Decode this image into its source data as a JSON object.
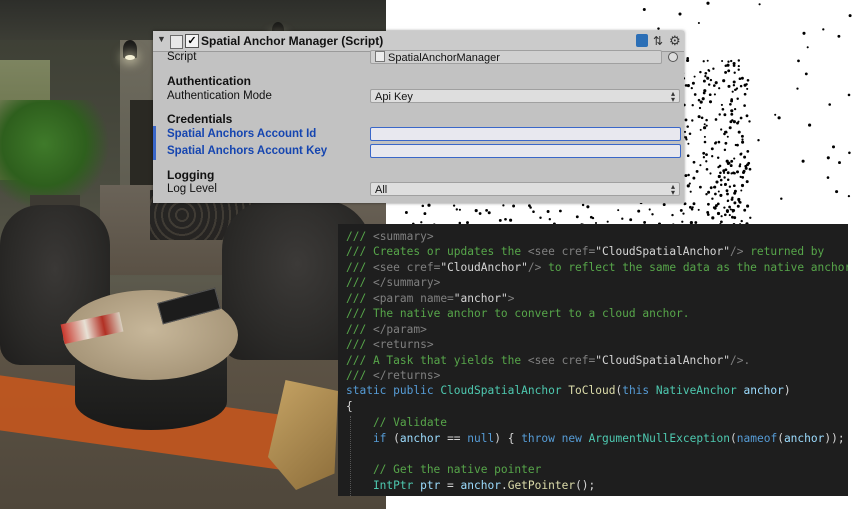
{
  "inspector": {
    "title": "Spatial Anchor Manager (Script)",
    "enabled": true,
    "script_label": "Script",
    "script_value": "SpatialAnchorManager",
    "sections": {
      "authentication": "Authentication",
      "credentials": "Credentials",
      "logging": "Logging"
    },
    "authentication_mode_label": "Authentication Mode",
    "authentication_mode_value": "Api Key",
    "account_id_label": "Spatial Anchors Account Id",
    "account_id_value": "",
    "account_key_label": "Spatial Anchors Account Key",
    "account_key_value": "",
    "log_level_label": "Log Level",
    "log_level_value": "All",
    "icons": [
      "foldout-arrow-icon",
      "script-icon",
      "enable-checkbox",
      "help-book-icon",
      "preset-sliders-icon",
      "gear-icon",
      "object-picker-icon",
      "dropdown-arrows-icon"
    ]
  },
  "code": {
    "lines": [
      {
        "parts": [
          [
            "c-cm",
            "/// "
          ],
          [
            "c-xml",
            "<summary>"
          ]
        ]
      },
      {
        "parts": [
          [
            "c-cm",
            "/// "
          ],
          [
            "c-cm",
            "Creates or updates the "
          ],
          [
            "c-xml",
            "<see "
          ],
          [
            "c-xml",
            "cref="
          ],
          [
            "c-str",
            "\"CloudSpatialAnchor\""
          ],
          [
            "c-xml",
            "/>"
          ],
          [
            "c-cm",
            " returned by"
          ]
        ]
      },
      {
        "parts": [
          [
            "c-cm",
            "/// "
          ],
          [
            "c-xml",
            "<see "
          ],
          [
            "c-xml",
            "cref="
          ],
          [
            "c-str",
            "\"CloudAnchor\""
          ],
          [
            "c-xml",
            "/>"
          ],
          [
            "c-cm",
            " to reflect the same data as the native anchor."
          ]
        ]
      },
      {
        "parts": [
          [
            "c-cm",
            "/// "
          ],
          [
            "c-xml",
            "</summary>"
          ]
        ]
      },
      {
        "parts": [
          [
            "c-cm",
            "/// "
          ],
          [
            "c-xml",
            "<param "
          ],
          [
            "c-xml",
            "name="
          ],
          [
            "c-str",
            "\"anchor\""
          ],
          [
            "c-xml",
            ">"
          ]
        ]
      },
      {
        "parts": [
          [
            "c-cm",
            "/// "
          ],
          [
            "c-cm",
            "The native anchor to convert to a cloud anchor."
          ]
        ]
      },
      {
        "parts": [
          [
            "c-cm",
            "/// "
          ],
          [
            "c-xml",
            "</param>"
          ]
        ]
      },
      {
        "parts": [
          [
            "c-cm",
            "/// "
          ],
          [
            "c-xml",
            "<returns>"
          ]
        ]
      },
      {
        "parts": [
          [
            "c-cm",
            "/// "
          ],
          [
            "c-cm",
            "A Task that yields the "
          ],
          [
            "c-xml",
            "<see "
          ],
          [
            "c-xml",
            "cref="
          ],
          [
            "c-str",
            "\"CloudSpatialAnchor\""
          ],
          [
            "c-xml",
            "/>."
          ]
        ]
      },
      {
        "parts": [
          [
            "c-cm",
            "/// "
          ],
          [
            "c-xml",
            "</returns>"
          ]
        ]
      },
      {
        "parts": [
          [
            "c-kw",
            "static "
          ],
          [
            "c-kw",
            "public "
          ],
          [
            "c-ty",
            "CloudSpatialAnchor "
          ],
          [
            "c-fn",
            "ToCloud"
          ],
          [
            "c-str",
            "("
          ],
          [
            "c-kw",
            "this "
          ],
          [
            "c-ty",
            "NativeAnchor "
          ],
          [
            "c-id",
            "anchor"
          ],
          [
            "c-str",
            ")"
          ]
        ]
      },
      {
        "parts": [
          [
            "c-str",
            "{"
          ]
        ]
      },
      {
        "parts": [
          [
            "c-cm",
            "    // Validate"
          ]
        ]
      },
      {
        "parts": [
          [
            "c-kw",
            "    if "
          ],
          [
            "c-str",
            "("
          ],
          [
            "c-id",
            "anchor"
          ],
          [
            "c-str",
            " == "
          ],
          [
            "c-kw",
            "null"
          ],
          [
            "c-str",
            ") { "
          ],
          [
            "c-kw",
            "throw "
          ],
          [
            "c-kw",
            "new "
          ],
          [
            "c-ty",
            "ArgumentNullException"
          ],
          [
            "c-str",
            "("
          ],
          [
            "c-kw",
            "nameof"
          ],
          [
            "c-str",
            "("
          ],
          [
            "c-id",
            "anchor"
          ],
          [
            "c-str",
            "));"
          ],
          [
            "c-str",
            " }"
          ]
        ]
      },
      {
        "parts": [
          [
            "c-str",
            " "
          ]
        ]
      },
      {
        "parts": [
          [
            "c-cm",
            "    // Get the native pointer"
          ]
        ]
      },
      {
        "parts": [
          [
            "c-ty",
            "    IntPtr "
          ],
          [
            "c-id",
            "ptr"
          ],
          [
            "c-str",
            " = "
          ],
          [
            "c-id",
            "anchor"
          ],
          [
            "c-str",
            "."
          ],
          [
            "c-fn",
            "GetPointer"
          ],
          [
            "c-str",
            "();"
          ]
        ]
      }
    ]
  },
  "colors": {
    "inspector_bg": "#c2c2c2",
    "accent_blue": "#3a67c9",
    "code_bg": "#1e1e1e",
    "comment": "#57a64a",
    "keyword": "#569cd6",
    "type": "#4ec9b0"
  }
}
